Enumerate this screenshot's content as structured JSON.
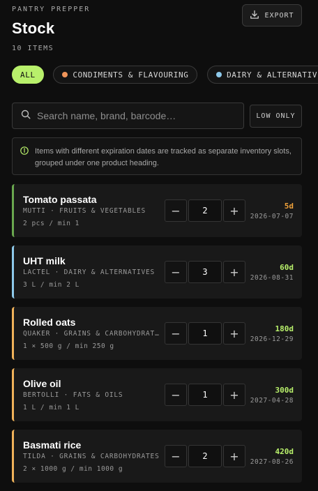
{
  "header": {
    "app_name": "PANTRY PREPPER",
    "title": "Stock",
    "item_count": "10 ITEMS",
    "export_label": "EXPORT",
    "export_icon": "download-icon"
  },
  "filters": [
    {
      "label": "ALL",
      "active": true,
      "color": ""
    },
    {
      "label": "CONDIMENTS & FLAVOURING",
      "active": false,
      "color": "#f0955a"
    },
    {
      "label": "DAIRY & ALTERNATIVES",
      "active": false,
      "color": "#8ec9ea"
    }
  ],
  "search": {
    "placeholder": "Search name, brand, barcode…",
    "value": "",
    "icon": "search-icon"
  },
  "low_only_label": "LOW ONLY",
  "info_text": "Items with different expiration dates are tracked as separate inventory slots, grouped under one product heading.",
  "items": [
    {
      "name": "Tomato passata",
      "brand": "MUTTI",
      "category": "FRUITS & VEGETABLES",
      "meta": "MUTTI · FRUITS & VEGETABLES",
      "quantity_info": "2 pcs / min 1",
      "quantity": "2",
      "days_left": "5d",
      "expiry": "2026-07-07",
      "stripe_color": "#6aa84f",
      "days_color": "#f0a23a"
    },
    {
      "name": "UHT milk",
      "brand": "LACTEL",
      "category": "DAIRY & ALTERNATIVES",
      "meta": "LACTEL · DAIRY & ALTERNATIVES",
      "quantity_info": "3 L / min 2 L",
      "quantity": "3",
      "days_left": "60d",
      "expiry": "2026-08-31",
      "stripe_color": "#8ec9ea",
      "days_color": "#b8f06b"
    },
    {
      "name": "Rolled oats",
      "brand": "QUAKER",
      "category": "GRAINS & CARBOHYDRATES",
      "meta": "QUAKER · GRAINS & CARBOHYDRATES",
      "quantity_info": "1 × 500 g / min 250 g",
      "quantity": "1",
      "days_left": "180d",
      "expiry": "2026-12-29",
      "stripe_color": "#f0b25a",
      "days_color": "#b8f06b"
    },
    {
      "name": "Olive oil",
      "brand": "BERTOLLI",
      "category": "FATS & OILS",
      "meta": "BERTOLLI · FATS & OILS",
      "quantity_info": "1 L / min 1 L",
      "quantity": "1",
      "days_left": "300d",
      "expiry": "2027-04-28",
      "stripe_color": "#f0b25a",
      "days_color": "#b8f06b"
    },
    {
      "name": "Basmati rice",
      "brand": "TILDA",
      "category": "GRAINS & CARBOHYDRATES",
      "meta": "TILDA · GRAINS & CARBOHYDRATES",
      "quantity_info": "2 × 1000 g / min 1000 g",
      "quantity": "2",
      "days_left": "420d",
      "expiry": "2027-08-26",
      "stripe_color": "#f0b25a",
      "days_color": "#b8f06b"
    }
  ],
  "stepper": {
    "minus": "−",
    "plus": "+"
  }
}
